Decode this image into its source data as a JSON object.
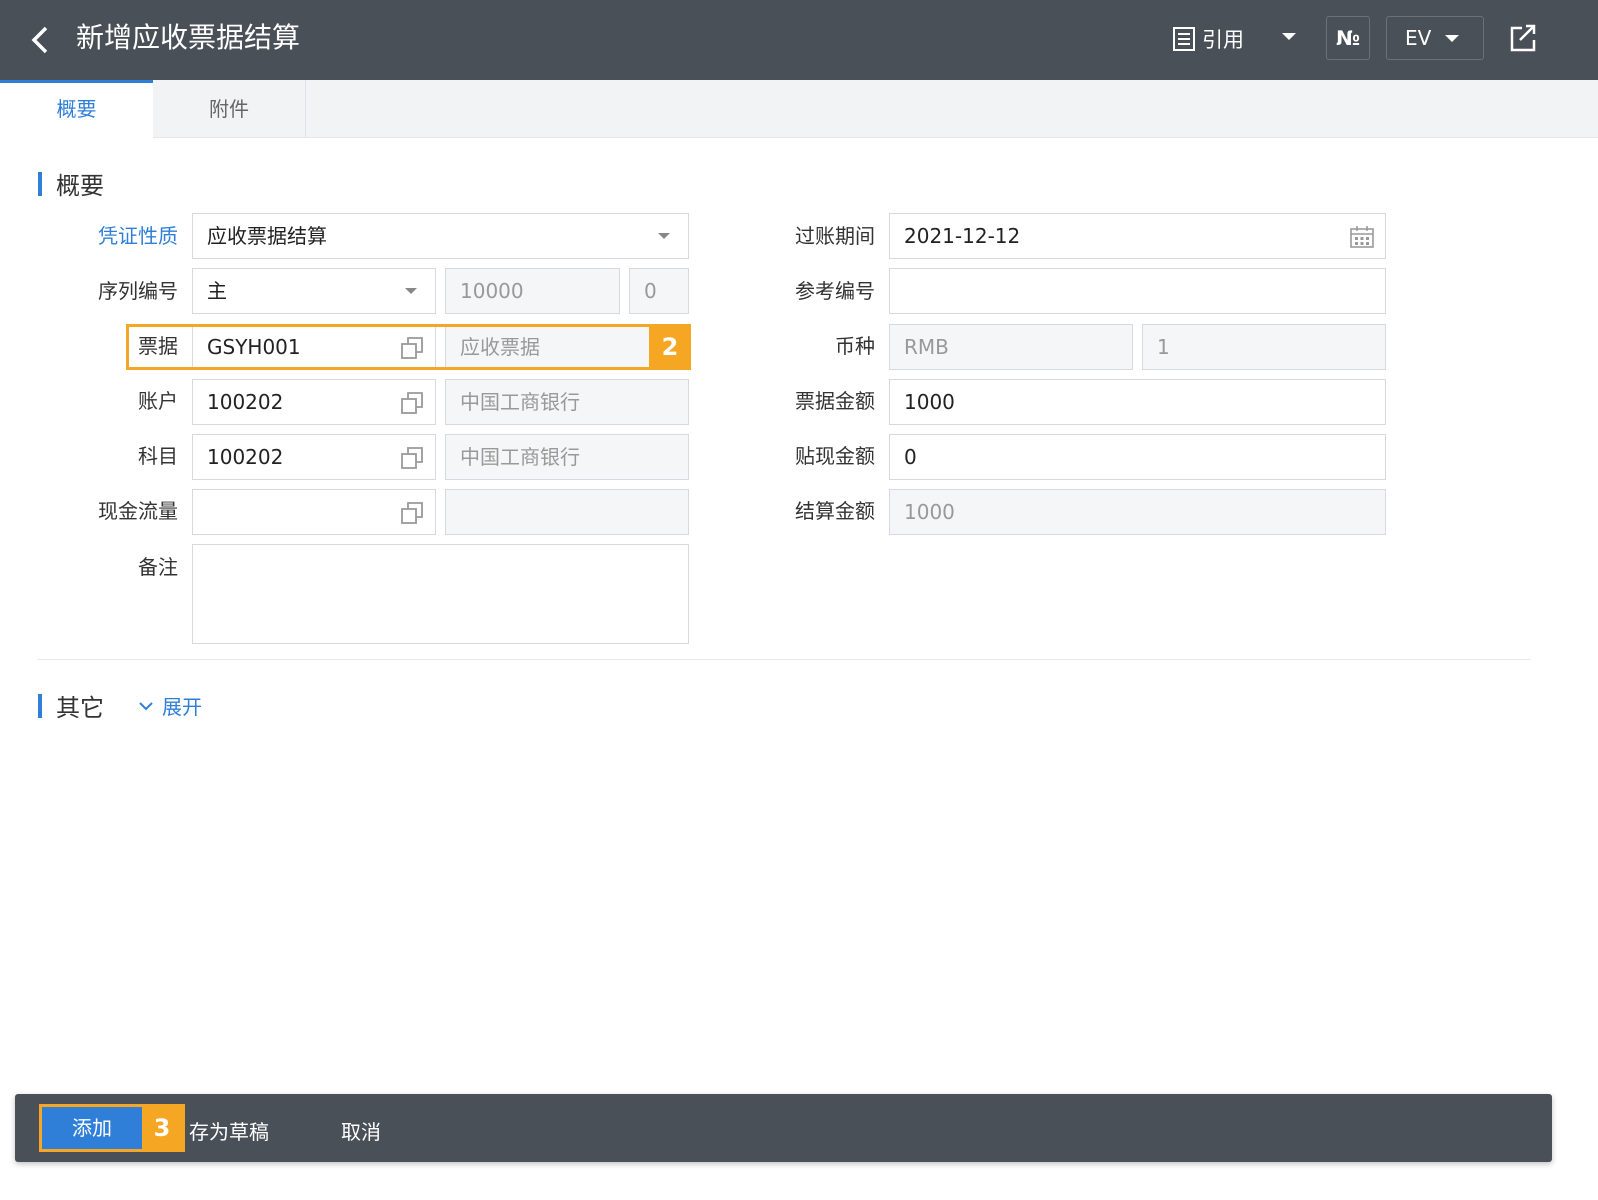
{
  "header": {
    "title": "新增应收票据结算",
    "reference_label": "引用",
    "number_label": "№",
    "ev_label": "EV"
  },
  "tabs": [
    {
      "label": "概要",
      "active": true
    },
    {
      "label": "附件",
      "active": false
    }
  ],
  "sections": {
    "summary_title": "概要",
    "other_title": "其它",
    "expand_label": "展开"
  },
  "form": {
    "voucher_type": {
      "label": "凭证性质",
      "value": "应收票据结算"
    },
    "sequence": {
      "label": "序列编号",
      "value": "主",
      "number": "10000",
      "suffix": "0"
    },
    "bill": {
      "label": "票据",
      "code": "GSYH001",
      "name": "应收票据"
    },
    "account": {
      "label": "账户",
      "code": "100202",
      "name": "中国工商银行"
    },
    "subject": {
      "label": "科目",
      "code": "100202",
      "name": "中国工商银行"
    },
    "cash_flow": {
      "label": "现金流量",
      "code": "",
      "name": ""
    },
    "remark": {
      "label": "备注",
      "value": ""
    },
    "posting_date": {
      "label": "过账期间",
      "value": "2021-12-12"
    },
    "reference_no": {
      "label": "参考编号",
      "value": ""
    },
    "currency": {
      "label": "币种",
      "value": "RMB",
      "rate": "1"
    },
    "bill_amount": {
      "label": "票据金额",
      "value": "1000"
    },
    "discount_amount": {
      "label": "贴现金额",
      "value": "0"
    },
    "settle_amount": {
      "label": "结算金额",
      "value": "1000"
    }
  },
  "annotations": {
    "bill_step": "2",
    "add_step": "3"
  },
  "actions": {
    "add_label": "添加",
    "draft_label": "存为草稿",
    "cancel_label": "取消"
  },
  "colors": {
    "header_bg": "#4a5058",
    "accent": "#2f7fd8",
    "highlight": "#f5a623"
  },
  "icons": [
    "back-arrow-icon",
    "list-icon",
    "caret-down-icon",
    "share-icon",
    "copy-icon",
    "calendar-icon",
    "chevron-down-icon"
  ]
}
